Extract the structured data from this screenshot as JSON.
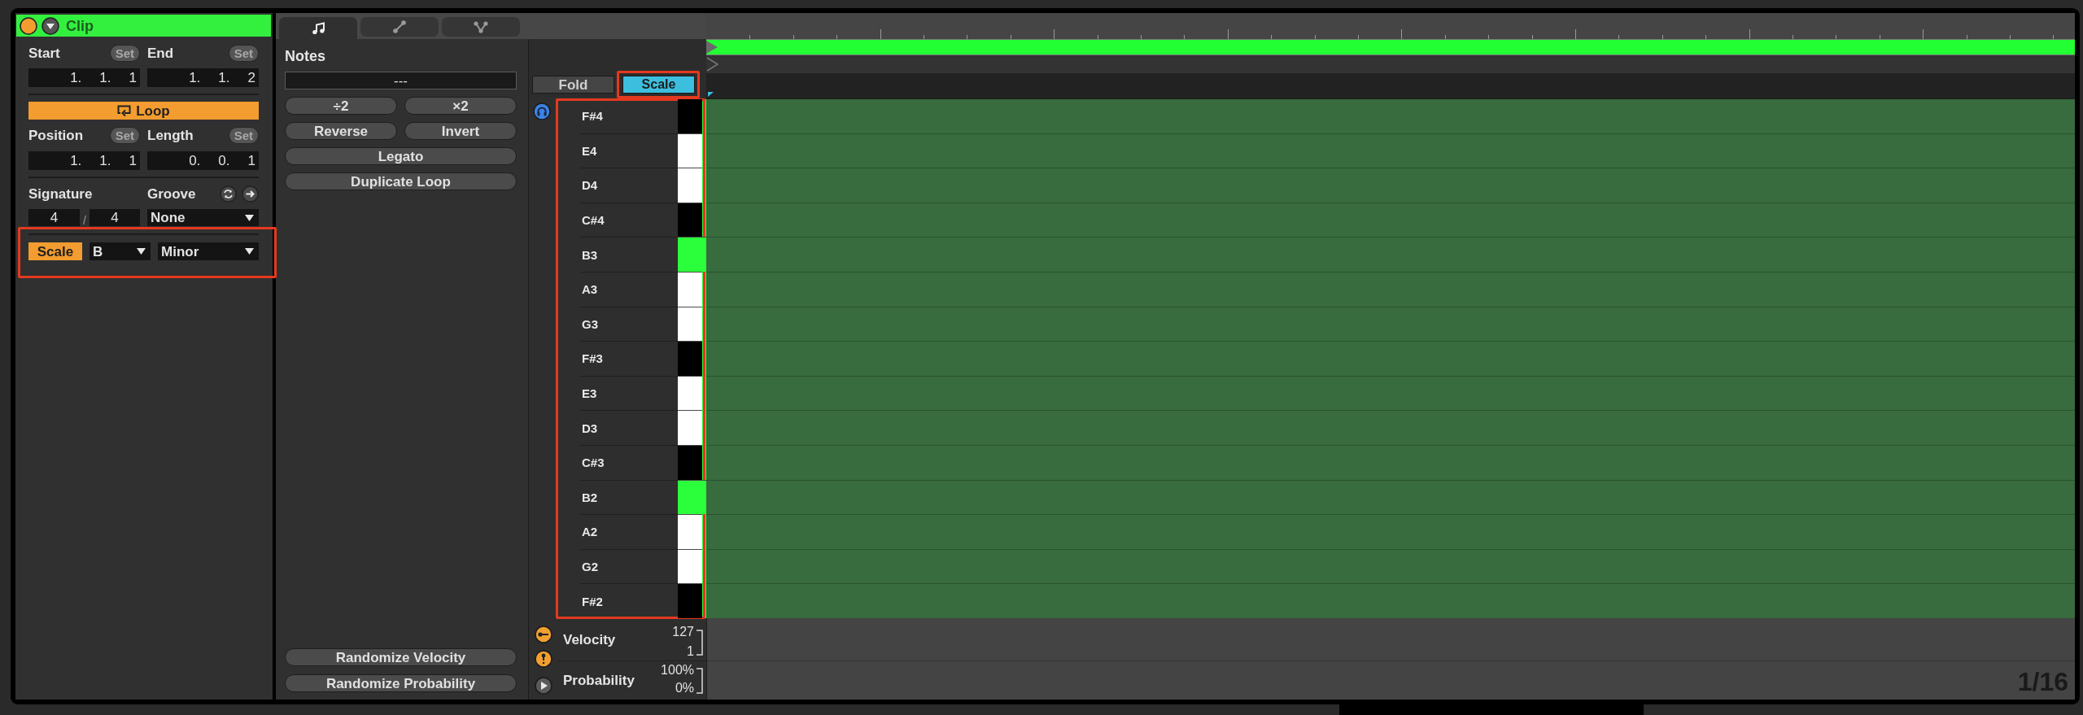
{
  "clip_panel": {
    "header": {
      "title": "Clip"
    },
    "range_fields": [
      {
        "label": "Start",
        "button": "Set",
        "value": [
          "1.",
          "1.",
          "1"
        ]
      },
      {
        "label": "End",
        "button": "Set",
        "value": [
          "1.",
          "1.",
          "2"
        ]
      }
    ],
    "loop": {
      "label": "Loop",
      "on": true
    },
    "loop_fields": [
      {
        "label": "Position",
        "button": "Set",
        "value": [
          "1.",
          "1.",
          "1"
        ]
      },
      {
        "label": "Length",
        "button": "Set",
        "value": [
          "0.",
          "0.",
          "1"
        ]
      }
    ],
    "signature": {
      "label": "Signature",
      "numerator": "4",
      "separator": "/",
      "denominator": "4"
    },
    "groove": {
      "label": "Groove",
      "value": "None"
    },
    "scale": {
      "label": "Scale",
      "on": true,
      "root": "B",
      "mode": "Minor"
    }
  },
  "tabs": [
    {
      "kind": "note",
      "selected": true
    },
    {
      "kind": "line",
      "selected": false
    },
    {
      "kind": "fork",
      "selected": false
    }
  ],
  "notes_panel": {
    "title": "Notes",
    "value": "---",
    "button_rows": [
      [
        "÷2",
        "×2"
      ],
      [
        "Reverse",
        "Invert"
      ],
      [
        "Legato"
      ],
      [
        "Duplicate Loop"
      ]
    ],
    "bottom_buttons": [
      "Randomize Velocity",
      "Randomize Probability"
    ]
  },
  "piano_roll": {
    "fold": {
      "label": "Fold",
      "on": false
    },
    "scale": {
      "label": "Scale",
      "on": true
    },
    "keys": [
      {
        "label": "F#4",
        "kind": "black",
        "root": false
      },
      {
        "label": "E4",
        "kind": "white",
        "root": false
      },
      {
        "label": "D4",
        "kind": "white",
        "root": false
      },
      {
        "label": "C#4",
        "kind": "black",
        "root": false
      },
      {
        "label": "B3",
        "kind": "white",
        "root": true
      },
      {
        "label": "A3",
        "kind": "white",
        "root": false
      },
      {
        "label": "G3",
        "kind": "white",
        "root": false
      },
      {
        "label": "F#3",
        "kind": "black",
        "root": false
      },
      {
        "label": "E3",
        "kind": "white",
        "root": false
      },
      {
        "label": "D3",
        "kind": "white",
        "root": false
      },
      {
        "label": "C#3",
        "kind": "black",
        "root": false
      },
      {
        "label": "B2",
        "kind": "white",
        "root": true
      },
      {
        "label": "A2",
        "kind": "white",
        "root": false
      },
      {
        "label": "G2",
        "kind": "white",
        "root": false
      },
      {
        "label": "F#2",
        "kind": "black",
        "root": false
      }
    ]
  },
  "lanes": [
    {
      "label": "Velocity",
      "max": "127",
      "min": "1"
    },
    {
      "label": "Probability",
      "max": "100%",
      "min": "0%"
    }
  ],
  "grid_resolution": "1/16"
}
